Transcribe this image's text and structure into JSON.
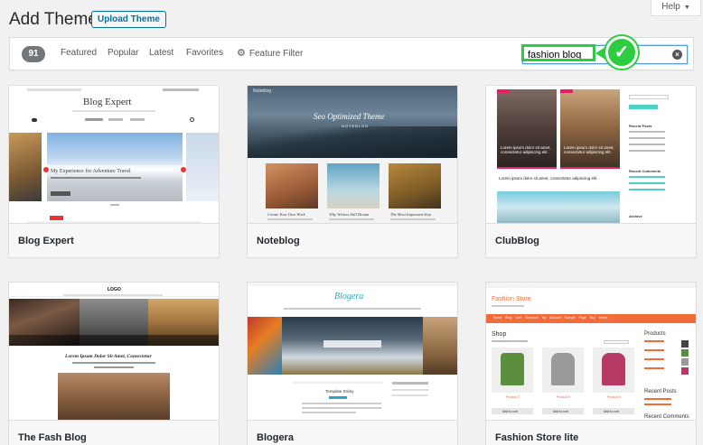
{
  "header": {
    "title": "Add Themes",
    "upload_label": "Upload Theme",
    "help_label": "Help"
  },
  "filter": {
    "count": "91",
    "tabs": [
      "Featured",
      "Popular",
      "Latest",
      "Favorites"
    ],
    "feature_filter_label": "Feature Filter",
    "search_value": "fashion blog"
  },
  "colors": {
    "wp_blue": "#0071a1",
    "highlight_green": "#2ecc40",
    "count_badge": "#72777c"
  },
  "themes": [
    {
      "name": "Blog Expert",
      "preview": {
        "logo": "Blog Expert",
        "slide_caption": "My Experience for Adventure Travel"
      }
    },
    {
      "name": "Noteblog",
      "preview": {
        "hero_title": "Seo Optimized Theme",
        "hero_subtitle": "NOTEBLOG",
        "posts": [
          "Create Your Own Work",
          "Why Writers Still Dream",
          "The Most Important Step"
        ]
      }
    },
    {
      "name": "ClubBlog",
      "preview": {
        "caption": "Lorem ipsum dolor sit amet, consectetur adipiscing elit.",
        "sidebar_headings": [
          "Recent Posts",
          "Recent Comments",
          "Archive"
        ]
      }
    },
    {
      "name": "The Fash Blog",
      "preview": {
        "logo": "LOGO",
        "headline": "Lorem Ipsum Dolor Sit Amet, Consectetur"
      }
    },
    {
      "name": "Blogera",
      "preview": {
        "logo": "Blogera",
        "post_title": "Template Sticky"
      }
    },
    {
      "name": "Fashion Store lite",
      "preview": {
        "logo": "Fashion Store",
        "nav": [
          "Home",
          "Blog",
          "Cart",
          "Checkout",
          "My Account",
          "Sample Page",
          "Buy theme"
        ],
        "shop_label": "Shop",
        "sidebar_products": "Products",
        "sidebar_recent_posts": "Recent Posts",
        "sidebar_recent_comments": "Recent Comments",
        "products": [
          {
            "name": "Product 3",
            "button": "Add to cart"
          },
          {
            "name": "Product 5",
            "button": "Add to cart"
          },
          {
            "name": "Product 6",
            "button": "Add to cart"
          }
        ]
      }
    }
  ]
}
